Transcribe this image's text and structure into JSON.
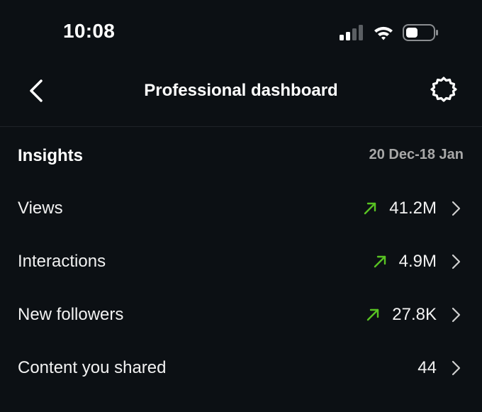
{
  "status_bar": {
    "time": "10:08",
    "icons": [
      "cellular-signal-icon",
      "wifi-icon",
      "battery-icon"
    ]
  },
  "header": {
    "title": "Professional dashboard",
    "back_icon": "chevron-left-icon",
    "settings_icon": "gear-icon"
  },
  "insights": {
    "title": "Insights",
    "date_range": "20 Dec-18 Jan",
    "metrics": [
      {
        "label": "Views",
        "value": "41.2M",
        "trend": "up"
      },
      {
        "label": "Interactions",
        "value": "4.9M",
        "trend": "up"
      },
      {
        "label": "New followers",
        "value": "27.8K",
        "trend": "up"
      },
      {
        "label": "Content you shared",
        "value": "44",
        "trend": "none"
      }
    ]
  },
  "colors": {
    "background": "#0c1014",
    "text_primary": "#f5f5f5",
    "text_secondary": "#a8a8a8",
    "trend_up": "#58c322",
    "divider": "#1e2328"
  }
}
